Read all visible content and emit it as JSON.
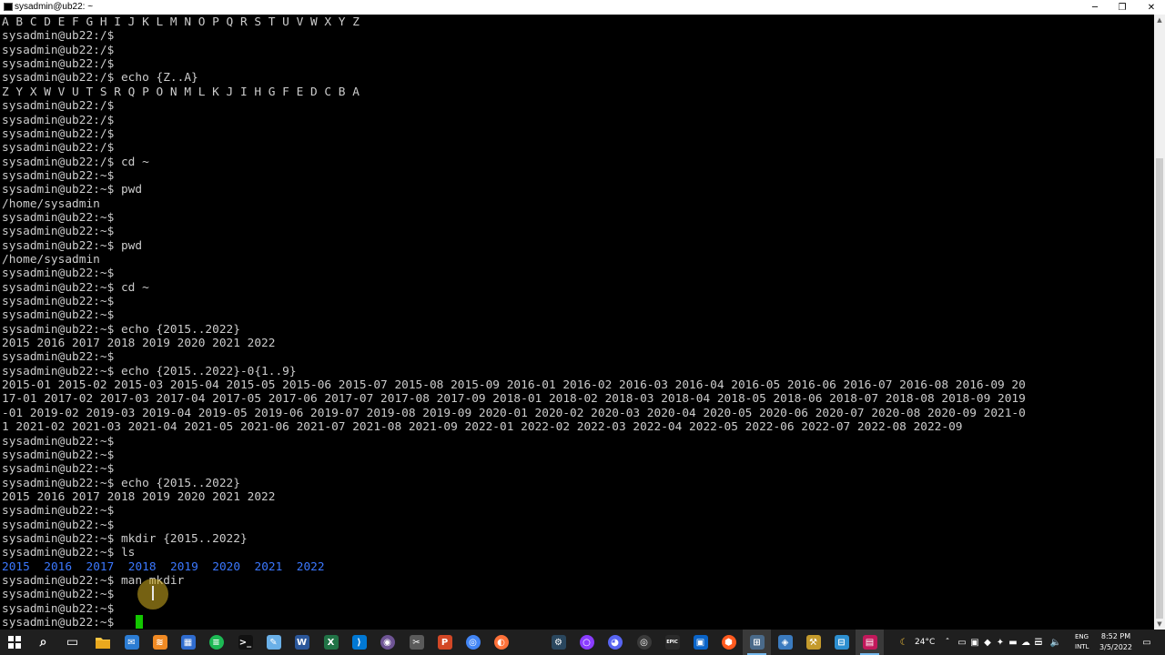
{
  "window": {
    "title": "sysadmin@ub22: ~",
    "minimize_glyph": "─",
    "maximize_glyph": "❐",
    "close_glyph": "✕"
  },
  "terminal": {
    "lines": [
      "A B C D E F G H I J K L M N O P Q R S T U V W X Y Z",
      "sysadmin@ub22:/$",
      "sysadmin@ub22:/$",
      "sysadmin@ub22:/$",
      "sysadmin@ub22:/$ echo {Z..A}",
      "Z Y X W V U T S R Q P O N M L K J I H G F E D C B A",
      "sysadmin@ub22:/$",
      "sysadmin@ub22:/$",
      "sysadmin@ub22:/$",
      "sysadmin@ub22:/$",
      "sysadmin@ub22:/$ cd ~",
      "sysadmin@ub22:~$",
      "sysadmin@ub22:~$ pwd",
      "/home/sysadmin",
      "sysadmin@ub22:~$",
      "sysadmin@ub22:~$",
      "sysadmin@ub22:~$ pwd",
      "/home/sysadmin",
      "sysadmin@ub22:~$",
      "sysadmin@ub22:~$ cd ~",
      "sysadmin@ub22:~$",
      "sysadmin@ub22:~$",
      "sysadmin@ub22:~$ echo {2015..2022}",
      "2015 2016 2017 2018 2019 2020 2021 2022",
      "sysadmin@ub22:~$",
      "sysadmin@ub22:~$ echo {2015..2022}-0{1..9}",
      "2015-01 2015-02 2015-03 2015-04 2015-05 2015-06 2015-07 2015-08 2015-09 2016-01 2016-02 2016-03 2016-04 2016-05 2016-06 2016-07 2016-08 2016-09 20",
      "17-01 2017-02 2017-03 2017-04 2017-05 2017-06 2017-07 2017-08 2017-09 2018-01 2018-02 2018-03 2018-04 2018-05 2018-06 2018-07 2018-08 2018-09 2019",
      "-01 2019-02 2019-03 2019-04 2019-05 2019-06 2019-07 2019-08 2019-09 2020-01 2020-02 2020-03 2020-04 2020-05 2020-06 2020-07 2020-08 2020-09 2021-0",
      "1 2021-02 2021-03 2021-04 2021-05 2021-06 2021-07 2021-08 2021-09 2022-01 2022-02 2022-03 2022-04 2022-05 2022-06 2022-07 2022-08 2022-09",
      "sysadmin@ub22:~$",
      "sysadmin@ub22:~$",
      "sysadmin@ub22:~$",
      "sysadmin@ub22:~$ echo {2015..2022}",
      "2015 2016 2017 2018 2019 2020 2021 2022",
      "sysadmin@ub22:~$",
      "sysadmin@ub22:~$",
      "sysadmin@ub22:~$ mkdir {2015..2022}",
      "sysadmin@ub22:~$ ls"
    ],
    "ls_output": [
      "2015",
      "2016",
      "2017",
      "2018",
      "2019",
      "2020",
      "2021",
      "2022"
    ],
    "lines_after": [
      "sysadmin@ub22:~$ man mkdir",
      "sysadmin@ub22:~$",
      "sysadmin@ub22:~$",
      "sysadmin@ub22:~$ "
    ],
    "colors": {
      "background": "#000000",
      "text": "#cccccc",
      "directory": "#3b78ff",
      "cursor": "#13c600"
    }
  },
  "scrollbar": {
    "up_glyph": "▲",
    "down_glyph": "▼"
  },
  "taskbar": {
    "apps": [
      {
        "name": "start-button",
        "icon": "windows-logo-icon",
        "glyph": "",
        "color": "#ffffff",
        "active": false
      },
      {
        "name": "search-button",
        "icon": "search-icon",
        "glyph": "⌕",
        "color": "#ffffff",
        "active": false
      },
      {
        "name": "task-view-button",
        "icon": "task-view-icon",
        "glyph": "▭",
        "color": "#ffffff",
        "active": false
      },
      {
        "name": "file-explorer-button",
        "icon": "folder-icon",
        "glyph": "",
        "color": "#f8c542",
        "active": false
      },
      {
        "name": "mail-button",
        "icon": "mail-icon",
        "glyph": "✉",
        "color": "#2b7cd3",
        "active": false
      },
      {
        "name": "layers-app-button",
        "icon": "layers-icon",
        "glyph": "≋",
        "color": "#f08a24",
        "active": false
      },
      {
        "name": "calculator-button",
        "icon": "calculator-icon",
        "glyph": "▦",
        "color": "#2f6ccf",
        "active": false
      },
      {
        "name": "spotify-button",
        "icon": "spotify-icon",
        "glyph": "≡",
        "color": "#1db954",
        "active": false
      },
      {
        "name": "terminal-button",
        "icon": "terminal-icon",
        "glyph": ">_",
        "color": "#111111",
        "active": false
      },
      {
        "name": "notepad-button",
        "icon": "notepad-icon",
        "glyph": "✎",
        "color": "#6ab0e8",
        "active": false
      },
      {
        "name": "word-button",
        "icon": "word-icon",
        "glyph": "W",
        "color": "#2b579a",
        "active": false
      },
      {
        "name": "excel-button",
        "icon": "excel-icon",
        "glyph": "X",
        "color": "#217346",
        "active": false
      },
      {
        "name": "vscode-button",
        "icon": "vscode-icon",
        "glyph": "⟩",
        "color": "#0078d4",
        "active": false
      },
      {
        "name": "github-desktop-button",
        "icon": "github-icon",
        "glyph": "◉",
        "color": "#6e5494",
        "active": false
      },
      {
        "name": "snipping-tool-button",
        "icon": "snip-icon",
        "glyph": "✂",
        "color": "#5a5a5a",
        "active": false
      },
      {
        "name": "powerpoint-button",
        "icon": "powerpoint-icon",
        "glyph": "P",
        "color": "#d24726",
        "active": false
      },
      {
        "name": "chrome-button",
        "icon": "chrome-icon",
        "glyph": "◎",
        "color": "#4285f4",
        "active": false
      },
      {
        "name": "firefox-button",
        "icon": "firefox-icon",
        "glyph": "◐",
        "color": "#ff7139",
        "active": false
      },
      {
        "name": "steam-button",
        "icon": "steam-icon",
        "glyph": "⚙",
        "color": "#2a475e",
        "active": false
      },
      {
        "name": "obs-button",
        "icon": "obs-icon",
        "glyph": "○",
        "color": "#8a3cff",
        "active": false
      },
      {
        "name": "discord-button",
        "icon": "discord-icon",
        "glyph": "◕",
        "color": "#5865f2",
        "active": false
      },
      {
        "name": "vpn-button",
        "icon": "target-icon",
        "glyph": "◎",
        "color": "#3a3a3a",
        "active": false
      },
      {
        "name": "epic-games-button",
        "icon": "epic-games-icon",
        "glyph": "EPIC",
        "color": "#2a2a2a",
        "active": false
      },
      {
        "name": "remote-desktop-button",
        "icon": "remote-desktop-icon",
        "glyph": "▣",
        "color": "#0a64c8",
        "active": false
      },
      {
        "name": "vpn-shield-button",
        "icon": "shield-icon",
        "glyph": "⬢",
        "color": "#ff5a1f",
        "active": false
      },
      {
        "name": "network-app-button",
        "icon": "network-icon",
        "glyph": "⊞",
        "color": "#4a6a8a",
        "active": true
      },
      {
        "name": "virtualbox-button",
        "icon": "cube-icon",
        "glyph": "◈",
        "color": "#3b7bbf",
        "active": false
      },
      {
        "name": "tools-button",
        "icon": "tools-icon",
        "glyph": "⚒",
        "color": "#c49a2c",
        "active": false
      },
      {
        "name": "network-monitor-button",
        "icon": "monitor-icon",
        "glyph": "⊟",
        "color": "#2d8fd0",
        "active": false
      },
      {
        "name": "terminal-window-button",
        "icon": "terminal-window-icon",
        "glyph": "▤",
        "color": "#c2185b",
        "active": true
      }
    ],
    "tray": {
      "weather_glyph": "☾",
      "weather_temp": "24°C",
      "chevron_glyph": "ˆ",
      "icons": [
        {
          "name": "tray-app-icon-1",
          "glyph": "▭"
        },
        {
          "name": "tray-app-icon-2",
          "glyph": "▣"
        },
        {
          "name": "tray-app-icon-3",
          "glyph": "◆"
        },
        {
          "name": "tray-app-icon-4",
          "glyph": "✦"
        },
        {
          "name": "tray-app-icon-5",
          "glyph": "▬"
        },
        {
          "name": "tray-app-icon-6",
          "glyph": "☁"
        },
        {
          "name": "tray-app-icon-7",
          "glyph": "▭"
        },
        {
          "name": "tray-app-icon-8",
          "glyph": "☰"
        },
        {
          "name": "tray-app-icon-9",
          "glyph": "◧"
        }
      ],
      "volume_glyph": "🔈",
      "language_top": "ENG",
      "language_bottom": "INTL",
      "time": "8:52 PM",
      "date": "3/5/2022",
      "notification_glyph": "▭"
    }
  }
}
